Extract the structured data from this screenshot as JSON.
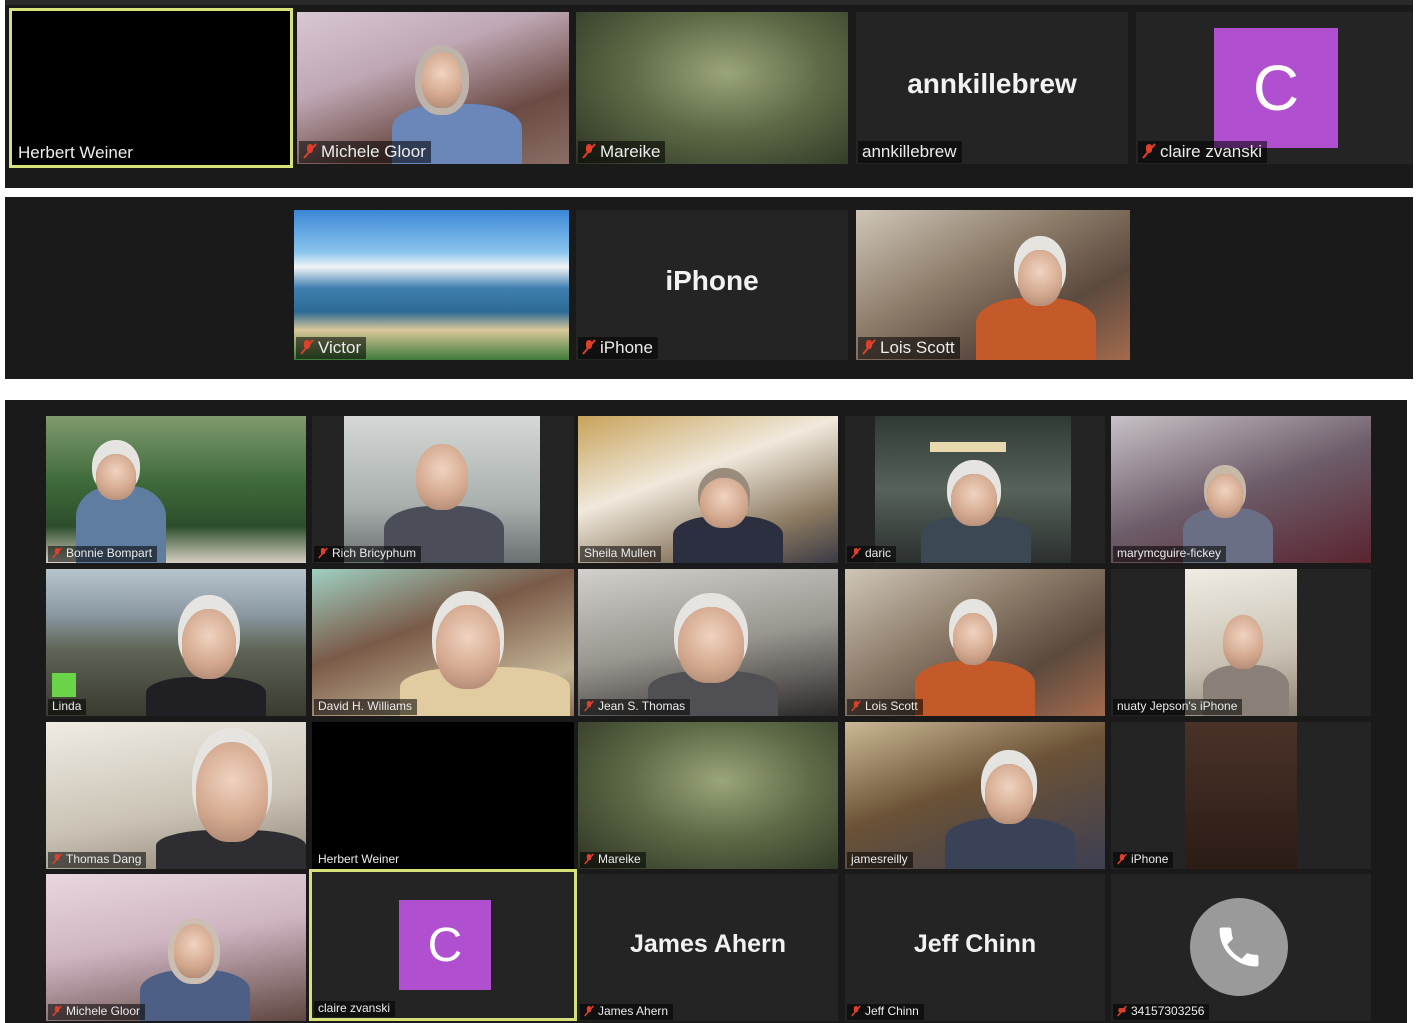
{
  "panels": [
    {
      "tiles": [
        {
          "name": "Herbert Weiner",
          "muted": false,
          "active": true
        },
        {
          "name": "Michele Gloor",
          "muted": true
        },
        {
          "name": "Mareike",
          "muted": true
        },
        {
          "name": "annkillebrew",
          "center_text": "annkillebrew",
          "muted": false
        },
        {
          "name": "claire zvanski",
          "avatar_letter": "C",
          "muted": true
        }
      ]
    },
    {
      "tiles": [
        {
          "name": "Victor",
          "muted": true
        },
        {
          "name": "iPhone",
          "center_text": "iPhone",
          "muted": true
        },
        {
          "name": "Lois Scott",
          "muted": true
        }
      ]
    },
    {
      "tiles": [
        {
          "name": "Bonnie Bompart",
          "muted": true
        },
        {
          "name": "Rich Bricyphum",
          "muted": true
        },
        {
          "name": "Sheila Mullen",
          "muted": false
        },
        {
          "name": "daric",
          "muted": true
        },
        {
          "name": "marymcguire-fickey",
          "muted": false
        },
        {
          "name": "Linda",
          "muted": false
        },
        {
          "name": "David H. Williams",
          "muted": false
        },
        {
          "name": "Jean S. Thomas",
          "muted": true
        },
        {
          "name": "Lois Scott",
          "muted": true
        },
        {
          "name": "nuaty Jepson's iPhone",
          "muted": false
        },
        {
          "name": "Thomas Dang",
          "muted": true
        },
        {
          "name": "Herbert Weiner",
          "muted": false
        },
        {
          "name": "Mareike",
          "muted": true
        },
        {
          "name": "jamesreilly",
          "muted": false
        },
        {
          "name": "iPhone",
          "muted": true
        },
        {
          "name": "Michele Gloor",
          "muted": true
        },
        {
          "name": "claire zvanski",
          "avatar_letter": "C",
          "muted": false,
          "active": true
        },
        {
          "name": "James Ahern",
          "center_text": "James Ahern",
          "muted": true
        },
        {
          "name": "Jeff Chinn",
          "center_text": "Jeff Chinn",
          "muted": true
        },
        {
          "name": "34157303256",
          "muted": true,
          "phone_icon": "phone-icon"
        }
      ]
    }
  ],
  "colors": {
    "panel_bg": "#1a1a1a",
    "tile_bg": "#242424",
    "active_speaker_border": "#d8e07a",
    "avatar_purple": "#b04fcf",
    "muted_icon": "#e0402b"
  }
}
